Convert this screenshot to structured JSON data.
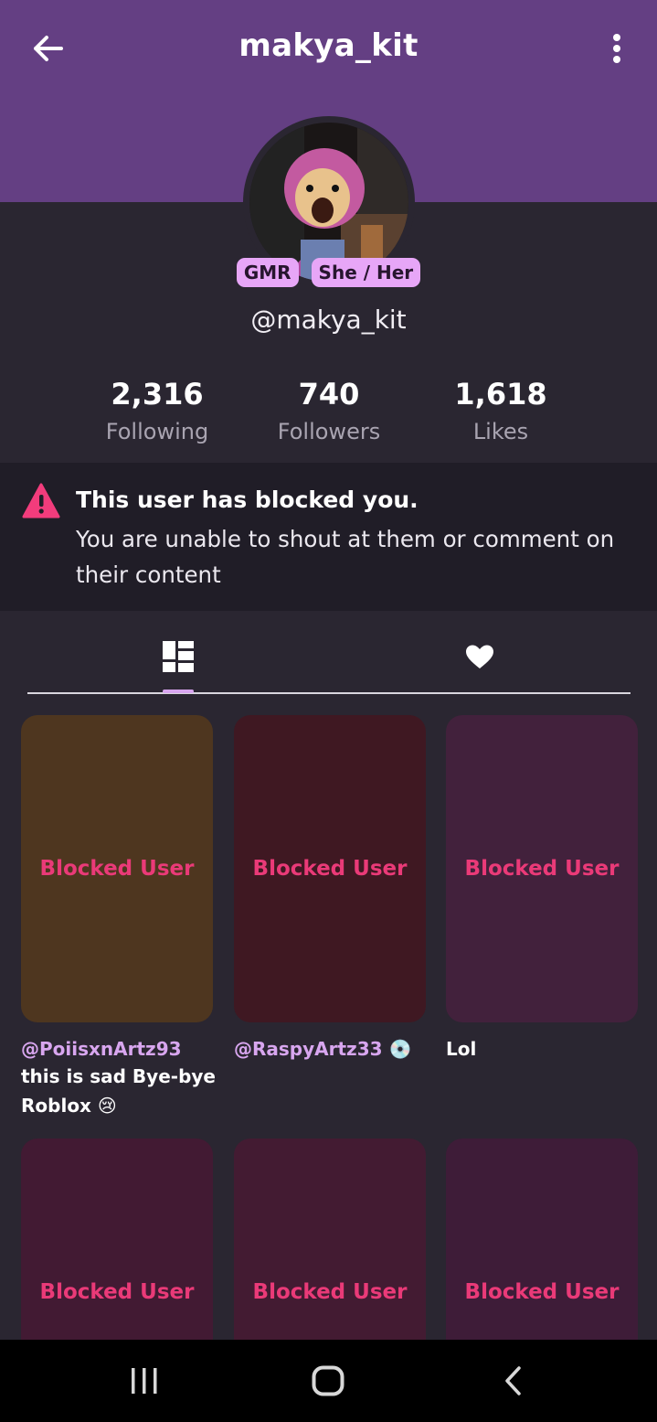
{
  "header": {
    "title": "makya_kit",
    "bg_color": "#643f83"
  },
  "profile": {
    "badges": [
      "GMR",
      "She / Her"
    ],
    "handle": "@makya_kit",
    "stats": [
      {
        "value": "2,316",
        "label": "Following"
      },
      {
        "value": "740",
        "label": "Followers"
      },
      {
        "value": "1,618",
        "label": "Likes"
      }
    ]
  },
  "blocked_notice": {
    "title": "This user has blocked you.",
    "message": "You are unable to shout at them or comment on their content",
    "icon": "warning-icon",
    "icon_color": "#f23c7c"
  },
  "tabs": [
    {
      "icon": "grid-icon",
      "active": true
    },
    {
      "icon": "heart-icon",
      "active": false
    }
  ],
  "posts": [
    {
      "label": "Blocked User",
      "bg": "#4e361f",
      "user": "@PoiisxnArtz93",
      "caption": "this is sad Bye-bye Roblox 😢"
    },
    {
      "label": "Blocked User",
      "bg": "#3f1822",
      "user": "@RaspyArtz33 💿",
      "caption": ""
    },
    {
      "label": "Blocked User",
      "bg": "#42213c",
      "user": "",
      "caption": "Lol"
    },
    {
      "label": "Blocked User",
      "bg": "#421a33"
    },
    {
      "label": "Blocked User",
      "bg": "#431b32"
    },
    {
      "label": "Blocked User",
      "bg": "#3e1c38"
    }
  ],
  "system_nav": [
    "recents-icon",
    "home-icon",
    "back-icon"
  ]
}
